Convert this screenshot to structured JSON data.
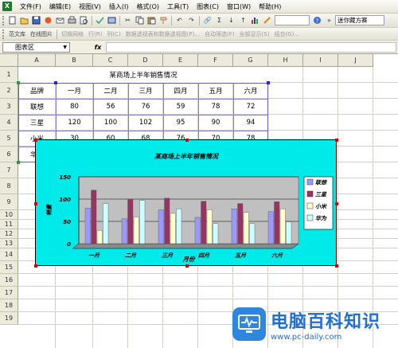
{
  "app": {
    "icon_glyph": "X"
  },
  "menu": [
    "文件(F)",
    "编辑(E)",
    "视图(V)",
    "插入(I)",
    "格式(O)",
    "工具(T)",
    "图表(C)",
    "窗口(W)",
    "帮助(H)"
  ],
  "toolbar": {
    "buttons": [
      "new-icon",
      "open-icon",
      "save-icon",
      "permission-icon",
      "email-icon",
      "print-icon",
      "print-preview-icon",
      "spellcheck-icon",
      "research-icon",
      "cut-icon",
      "copy-icon",
      "paste-icon",
      "format-painter-icon",
      "undo-icon",
      "redo-icon",
      "hyperlink-icon",
      "autosum-icon",
      "sort-asc-icon",
      "sort-desc-icon",
      "chart-wizard-icon",
      "drawing-icon",
      "zoom-dropdown",
      "help-icon"
    ],
    "help_placeholder": "迷你藏方赛"
  },
  "toolbar2": {
    "items": [
      "范文库",
      "在线图片",
      "切换网格",
      "行(R)",
      "列(C)",
      "数据透视表和数据透视图(P)...",
      "自动筛选(F)",
      "全部显示(S)",
      "组合(G)..."
    ]
  },
  "formula_bar": {
    "name_box": "图表区",
    "fx": "fx",
    "formula": ""
  },
  "columns": [
    "A",
    "B",
    "C",
    "D",
    "E",
    "F",
    "G",
    "H",
    "I",
    "J"
  ],
  "rows": [
    "1",
    "2",
    "3",
    "4",
    "5",
    "6",
    "7",
    "8",
    "9",
    "10",
    "11",
    "12",
    "13",
    "14",
    "15",
    "16",
    "17",
    "18",
    "19"
  ],
  "sheet": {
    "title": "某商场上半年销售情况",
    "headers": [
      "品牌",
      "一月",
      "二月",
      "三月",
      "四月",
      "五月",
      "六月"
    ],
    "data": [
      [
        "联想",
        "80",
        "56",
        "76",
        "59",
        "78",
        "72"
      ],
      [
        "三星",
        "120",
        "100",
        "102",
        "95",
        "90",
        "94"
      ],
      [
        "小米",
        "30",
        "60",
        "68",
        "76",
        "70",
        "78"
      ],
      [
        "华为",
        "90",
        "97",
        "78",
        "45",
        "45",
        "49"
      ]
    ]
  },
  "chart_data": {
    "type": "bar",
    "title": "某商场上半年销售情况",
    "xlabel": "月份",
    "ylabel": "销量",
    "categories": [
      "一月",
      "二月",
      "三月",
      "四月",
      "五月",
      "六月"
    ],
    "series": [
      {
        "name": "联想",
        "values": [
          80,
          56,
          76,
          59,
          78,
          72
        ],
        "color": "#9999ff"
      },
      {
        "name": "三星",
        "values": [
          120,
          100,
          102,
          95,
          90,
          94
        ],
        "color": "#993366"
      },
      {
        "name": "小米",
        "values": [
          30,
          60,
          68,
          76,
          70,
          78
        ],
        "color": "#ffffcc"
      },
      {
        "name": "华为",
        "values": [
          90,
          97,
          78,
          45,
          45,
          49
        ],
        "color": "#ccffff"
      }
    ],
    "yticks": [
      "0",
      "50",
      "100",
      "150"
    ],
    "ylim": [
      0,
      150
    ],
    "legend": "right",
    "plot_bg": "#c0c0c0",
    "chart_bg": "#00eaea"
  },
  "watermark": {
    "title": "电脑百科知识",
    "url": "www.pc-daily.com"
  }
}
